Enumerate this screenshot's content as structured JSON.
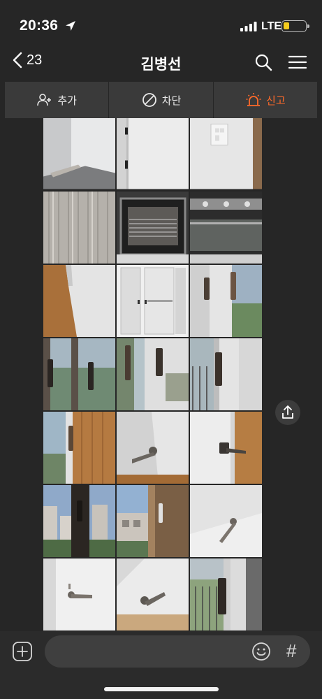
{
  "status_bar": {
    "time": "20:36",
    "network": "LTE",
    "battery_color": "#f5cc1e"
  },
  "header": {
    "back_count": "23",
    "title": "김병선"
  },
  "actions": [
    {
      "label": "추가",
      "icon": "add-friend-icon"
    },
    {
      "label": "차단",
      "icon": "block-icon"
    },
    {
      "label": "신고",
      "icon": "siren-icon",
      "color": "#ff6a2a"
    }
  ],
  "photos": [
    "photo-white-wall-corner",
    "photo-white-door-hinges",
    "photo-wall-switch",
    "photo-wood-panel-ceiling",
    "photo-oven-interior",
    "photo-appliance-interior",
    "photo-wood-floor-wall-corner",
    "photo-open-closet",
    "photo-window-handle-view",
    "photo-balcony-window-handles",
    "photo-window-handle-trees",
    "photo-window-handle-railing",
    "photo-window-wood-wall",
    "photo-door-lever-handle",
    "photo-door-lever-floor",
    "photo-apartment-view-window",
    "photo-city-view-window",
    "photo-lever-handle-wall",
    "photo-door-lever-white",
    "photo-door-lever-angled",
    "photo-window-handle-garden"
  ],
  "input": {
    "placeholder": "",
    "value": ""
  },
  "icons": {
    "back": "chevron-left-icon",
    "search": "search-icon",
    "menu": "hamburger-menu-icon",
    "share": "share-icon",
    "plus": "plus-icon",
    "emoji": "emoji-icon",
    "hash": "#"
  }
}
